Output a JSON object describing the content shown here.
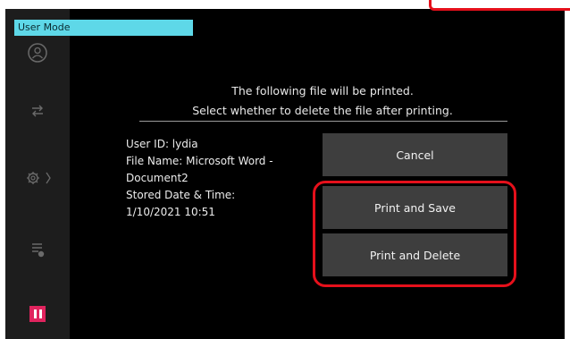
{
  "mode_tab": {
    "label": "User Mode"
  },
  "sidebar": {
    "items": [
      {
        "icon": "user-icon"
      },
      {
        "icon": "transfer-icon"
      },
      {
        "icon": "settings-icon"
      },
      {
        "icon": "job-status-icon"
      },
      {
        "icon": "pause-icon"
      }
    ]
  },
  "dialog": {
    "message_line1": "The following file will be printed.",
    "message_line2": "Select whether to delete the file after printing.",
    "info": {
      "user_id": "User ID: lydia",
      "file_name_1": "File Name: Microsoft Word -",
      "file_name_2": "Document2",
      "stored_label": "Stored Date & Time:",
      "stored_value": "1/10/2021 10:51"
    },
    "buttons": {
      "cancel": "Cancel",
      "print_and_save": "Print and Save",
      "print_and_delete": "Print and Delete"
    }
  },
  "colors": {
    "accent_tab": "#5ed8e8",
    "highlight": "#e5101b",
    "pause": "#e0245e",
    "button_bg": "#3e3e3e"
  }
}
